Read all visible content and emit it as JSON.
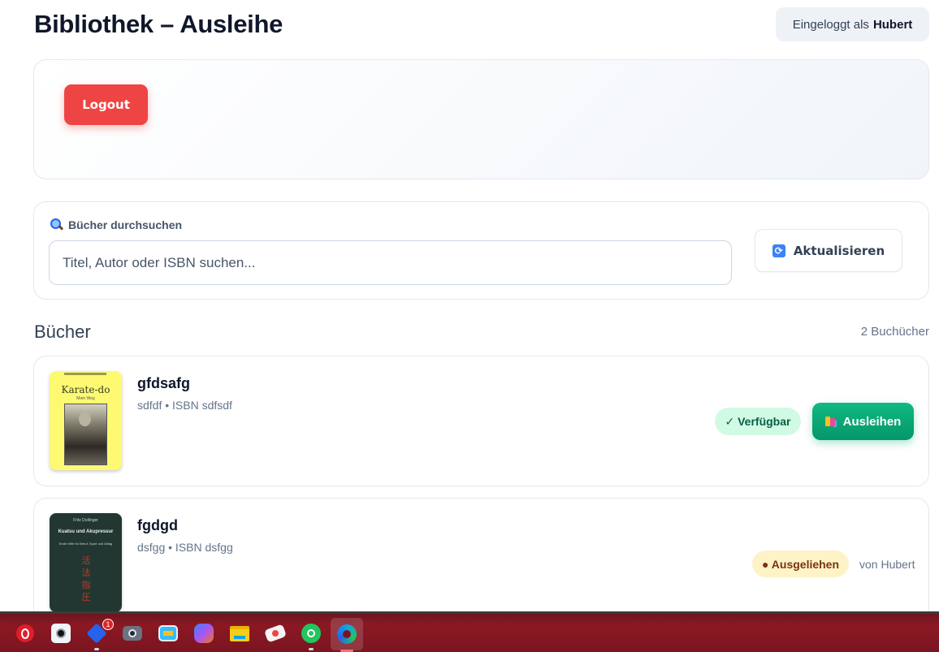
{
  "header": {
    "title": "Bibliothek – Ausleihe",
    "logged_in_prefix": "Eingeloggt als",
    "logged_in_user": "Hubert"
  },
  "top_panel": {
    "logout_label": "Logout"
  },
  "search": {
    "label": "Bücher durchsuchen",
    "placeholder": "Titel, Autor oder ISBN suchen...",
    "value": "",
    "refresh_label": "Aktualisieren"
  },
  "books_section": {
    "title": "Bücher",
    "count_label": "2 Buchücher",
    "items": [
      {
        "title": "gfdsafg",
        "meta": "sdfdf • ISBN sdfsdf",
        "status": "✓ Verfügbar",
        "action_label": "Ausleihen",
        "cover": {
          "title": "Karate-do",
          "subtitle": "Mein Weg"
        }
      },
      {
        "title": "fgdgd",
        "meta": "dsfgg • ISBN dsfgg",
        "status": "● Ausgeliehen",
        "borrower_label": "von Hubert",
        "cover": {
          "line1": "Fritz Dollinger",
          "title": "Kuatsu und Akupressur",
          "line3": "Erste Hilfe für Beruf, Sport und Alltag",
          "characters": "活法指圧"
        }
      }
    ]
  },
  "taskbar": {
    "apps": [
      {
        "icon": "opera-icon",
        "color": "#e11d2a"
      },
      {
        "icon": "camera-app-icon",
        "color": "#f1f5f9"
      },
      {
        "icon": "mail-icon",
        "color": "#2563eb",
        "badge": "1"
      },
      {
        "icon": "photo-camera-icon",
        "color": "#6b7280"
      },
      {
        "icon": "control-panel-icon",
        "color": "#38bdf8"
      },
      {
        "icon": "copilot-icon",
        "color": "#a855f7"
      },
      {
        "icon": "file-explorer-icon",
        "color": "#facc15"
      },
      {
        "icon": "paint-icon",
        "color": "#f5f5f4"
      },
      {
        "icon": "whatsapp-icon",
        "color": "#22c55e"
      },
      {
        "icon": "edge-icon",
        "color": "#0ea5e9"
      }
    ]
  }
}
